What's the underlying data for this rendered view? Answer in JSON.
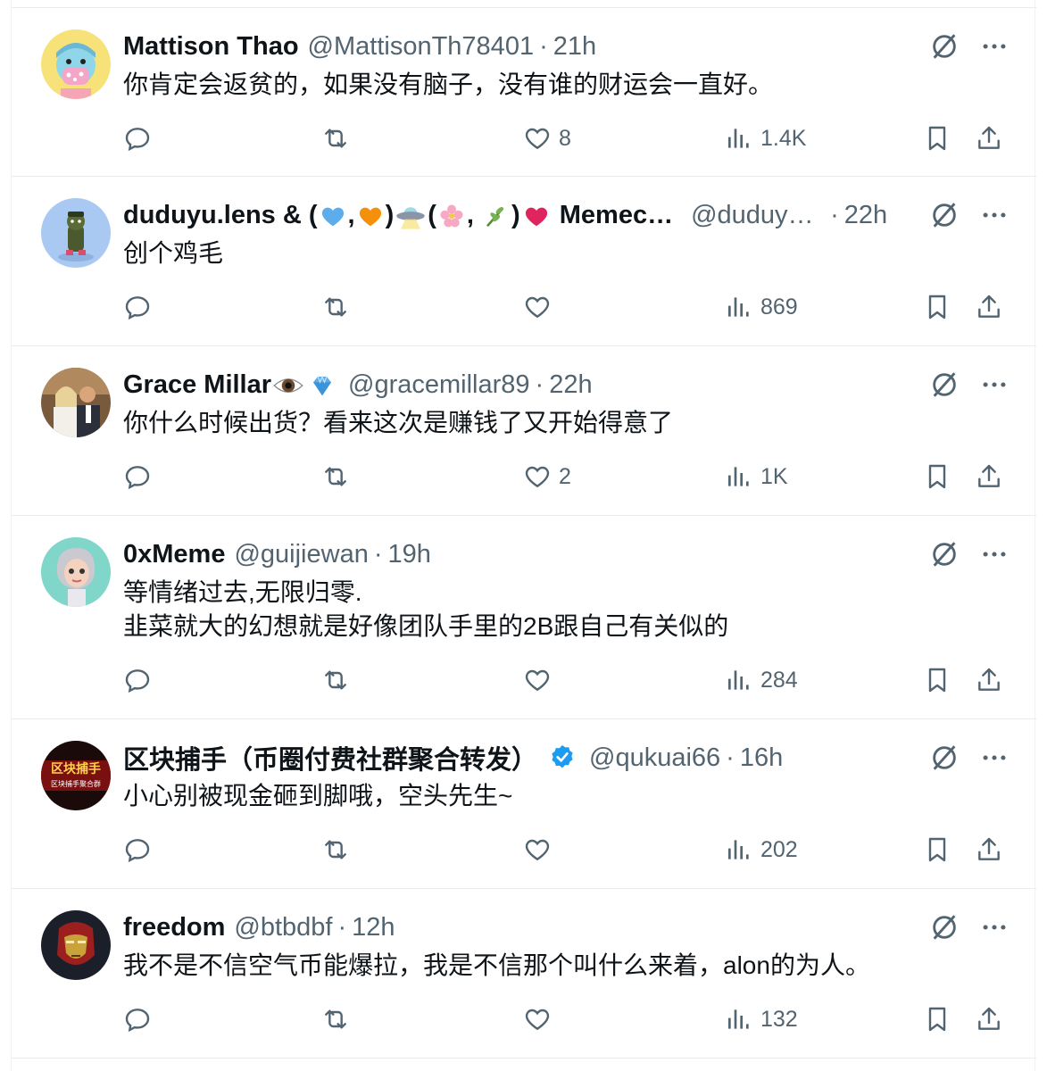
{
  "tweets": [
    {
      "name": "Mattison Thao",
      "handle": "@MattisonTh78401",
      "time": "21h",
      "lines": [
        "你肯定会返贫的，如果没有脑子，没有谁的财运会一直好。"
      ],
      "likes": "8",
      "views": "1.4K",
      "avatar_icon": "avatar-cartoon-face"
    },
    {
      "name": "duduyu.lens & (",
      "name_rest": "Memec…",
      "handle": "@duduyu…",
      "time": "22h",
      "lines": [
        "创个鸡毛"
      ],
      "likes": "",
      "views": "869",
      "avatar_icon": "avatar-cartoon-figure"
    },
    {
      "name": "Grace Millar",
      "handle": "@gracemillar89",
      "time": "22h",
      "lines": [
        "你什么时候出货？看来这次是赚钱了又开始得意了"
      ],
      "likes": "2",
      "views": "1K",
      "avatar_icon": "avatar-photo-couple"
    },
    {
      "name": "0xMeme",
      "handle": "@guijiewan",
      "time": "19h",
      "lines": [
        "等情绪过去,无限归零.",
        "韭菜就大的幻想就是好像团队手里的2B跟自己有关似的"
      ],
      "likes": "",
      "views": "284",
      "avatar_icon": "avatar-3d-character"
    },
    {
      "name": "区块捕手（币圈付费社群聚合转发）",
      "handle": "@qukuai66",
      "time": "16h",
      "lines": [
        "小心别被现金砸到脚哦，空头先生~"
      ],
      "likes": "",
      "views": "202",
      "avatar_icon": "avatar-logo-red",
      "avatar_text": "区块捕手",
      "avatar_subtext": "区块捕手聚合群"
    },
    {
      "name": "freedom",
      "handle": "@btbdbf",
      "time": "12h",
      "lines": [
        "我不是不信空气币能爆拉，我是不信那个叫什么来着，alon的为人。"
      ],
      "likes": "",
      "views": "132",
      "avatar_icon": "avatar-ironman"
    }
  ],
  "separators": {
    "dot": "·",
    "comma": ",",
    "comma2": ", ",
    "close_paren": ")"
  },
  "colors": {
    "text": "#0f1419",
    "secondary": "#536471",
    "verified": "#1d9bf0",
    "heart_emoji": "#e0245e",
    "orange_heart": "#f4900c",
    "blue_heart": "#5dadec"
  }
}
